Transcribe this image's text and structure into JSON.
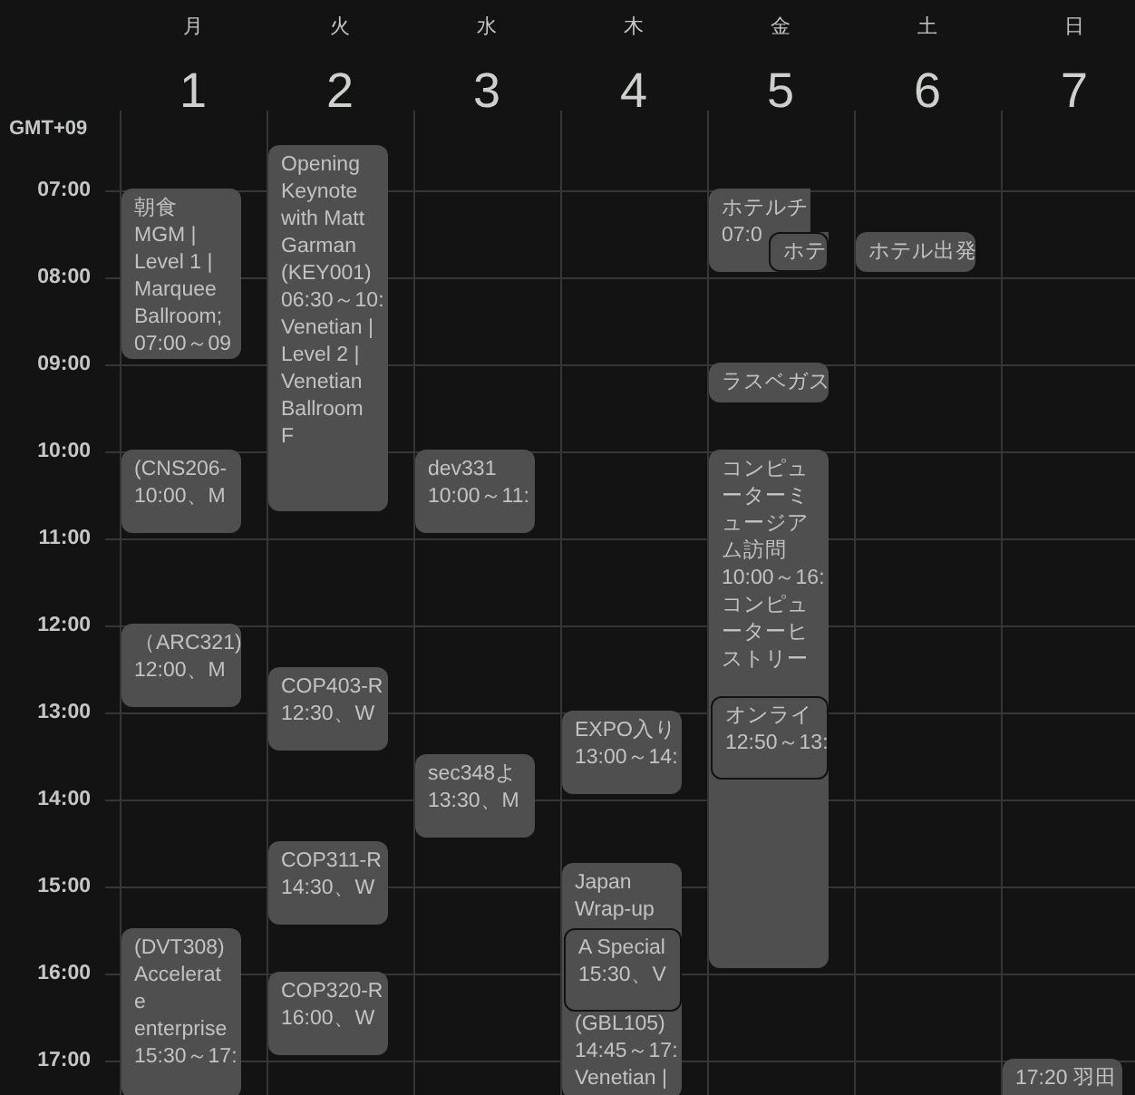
{
  "days": [
    {
      "weekday": "月",
      "date": "1",
      "events": [
        {
          "texts": [
            {
              "kind": "title",
              "text": "朝食 MGM | Level 1 | Marquee Ballroom;"
            },
            {
              "kind": "time",
              "text": "07:00～09"
            }
          ]
        },
        {
          "texts": [
            {
              "kind": "title",
              "text": "(CNS206-"
            },
            {
              "kind": "time",
              "text": "10:00、M"
            }
          ]
        },
        {
          "texts": [
            {
              "kind": "title",
              "text": "（ARC321)"
            },
            {
              "kind": "time",
              "text": "12:00、M"
            }
          ]
        },
        {
          "texts": [
            {
              "kind": "title",
              "text": "(DVT308) Accelerate enterprise"
            },
            {
              "kind": "time",
              "text": "15:30～17:"
            }
          ]
        }
      ]
    },
    {
      "weekday": "火",
      "date": "2",
      "events": [
        {
          "texts": [
            {
              "kind": "title",
              "text": "Opening Keynote with Matt Garman (KEY001)"
            },
            {
              "kind": "time",
              "text": "06:30～10:"
            },
            {
              "kind": "location",
              "text": "Venetian | Level 2 | Venetian Ballroom F"
            }
          ]
        },
        {
          "texts": [
            {
              "kind": "title",
              "text": "COP403-R"
            },
            {
              "kind": "time",
              "text": "12:30、W"
            }
          ]
        },
        {
          "texts": [
            {
              "kind": "title",
              "text": "COP311-R"
            },
            {
              "kind": "time",
              "text": "14:30、W"
            }
          ]
        },
        {
          "texts": [
            {
              "kind": "title",
              "text": "COP320-R"
            },
            {
              "kind": "time",
              "text": "16:00、W"
            }
          ]
        }
      ]
    },
    {
      "weekday": "水",
      "date": "3",
      "events": [
        {
          "texts": [
            {
              "kind": "title",
              "text": "dev331"
            },
            {
              "kind": "time",
              "text": "10:00～11:"
            }
          ]
        },
        {
          "texts": [
            {
              "kind": "title",
              "text": "sec348よ"
            },
            {
              "kind": "time",
              "text": "13:30、M"
            }
          ]
        }
      ]
    },
    {
      "weekday": "木",
      "date": "4",
      "events": [
        {
          "texts": [
            {
              "kind": "title",
              "text": "EXPO入り"
            },
            {
              "kind": "time",
              "text": "13:00～14:"
            }
          ]
        },
        {
          "texts": [
            {
              "kind": "title",
              "text": "Japan Wrap-up"
            },
            {
              "kind": "title",
              "text": "(GBL105)"
            },
            {
              "kind": "time",
              "text": "14:45～17:"
            },
            {
              "kind": "location",
              "text": "Venetian |"
            }
          ]
        },
        {
          "texts": [
            {
              "kind": "title",
              "text": "A Special"
            },
            {
              "kind": "time",
              "text": "15:30、V"
            }
          ]
        }
      ]
    },
    {
      "weekday": "金",
      "date": "5",
      "events": [
        {
          "texts": [
            {
              "kind": "title",
              "text": "ホテルチ"
            },
            {
              "kind": "time",
              "text": "07:0"
            }
          ]
        },
        {
          "texts": [
            {
              "kind": "title",
              "text": "ホテ"
            }
          ]
        },
        {
          "texts": [
            {
              "kind": "title",
              "text": "ラスベガス"
            }
          ]
        },
        {
          "texts": [
            {
              "kind": "title",
              "text": "コンピューターミュージアム訪問"
            },
            {
              "kind": "time",
              "text": "10:00～16:"
            },
            {
              "kind": "location",
              "text": "コンピューターヒストリー"
            }
          ]
        },
        {
          "texts": [
            {
              "kind": "title",
              "text": "オンライ"
            },
            {
              "kind": "time",
              "text": "12:50～13:"
            }
          ]
        }
      ]
    },
    {
      "weekday": "土",
      "date": "6",
      "events": [
        {
          "texts": [
            {
              "kind": "title",
              "text": "ホテル出発"
            }
          ]
        }
      ]
    },
    {
      "weekday": "日",
      "date": "7",
      "events": [
        {
          "texts": [
            {
              "kind": "title",
              "text": "17:20 羽田"
            }
          ]
        }
      ]
    }
  ],
  "timezone": "GMT+09",
  "hour_labels": [
    "07:00",
    "08:00",
    "09:00",
    "10:00",
    "11:00",
    "12:00",
    "13:00",
    "14:00",
    "15:00",
    "16:00",
    "17:00"
  ]
}
